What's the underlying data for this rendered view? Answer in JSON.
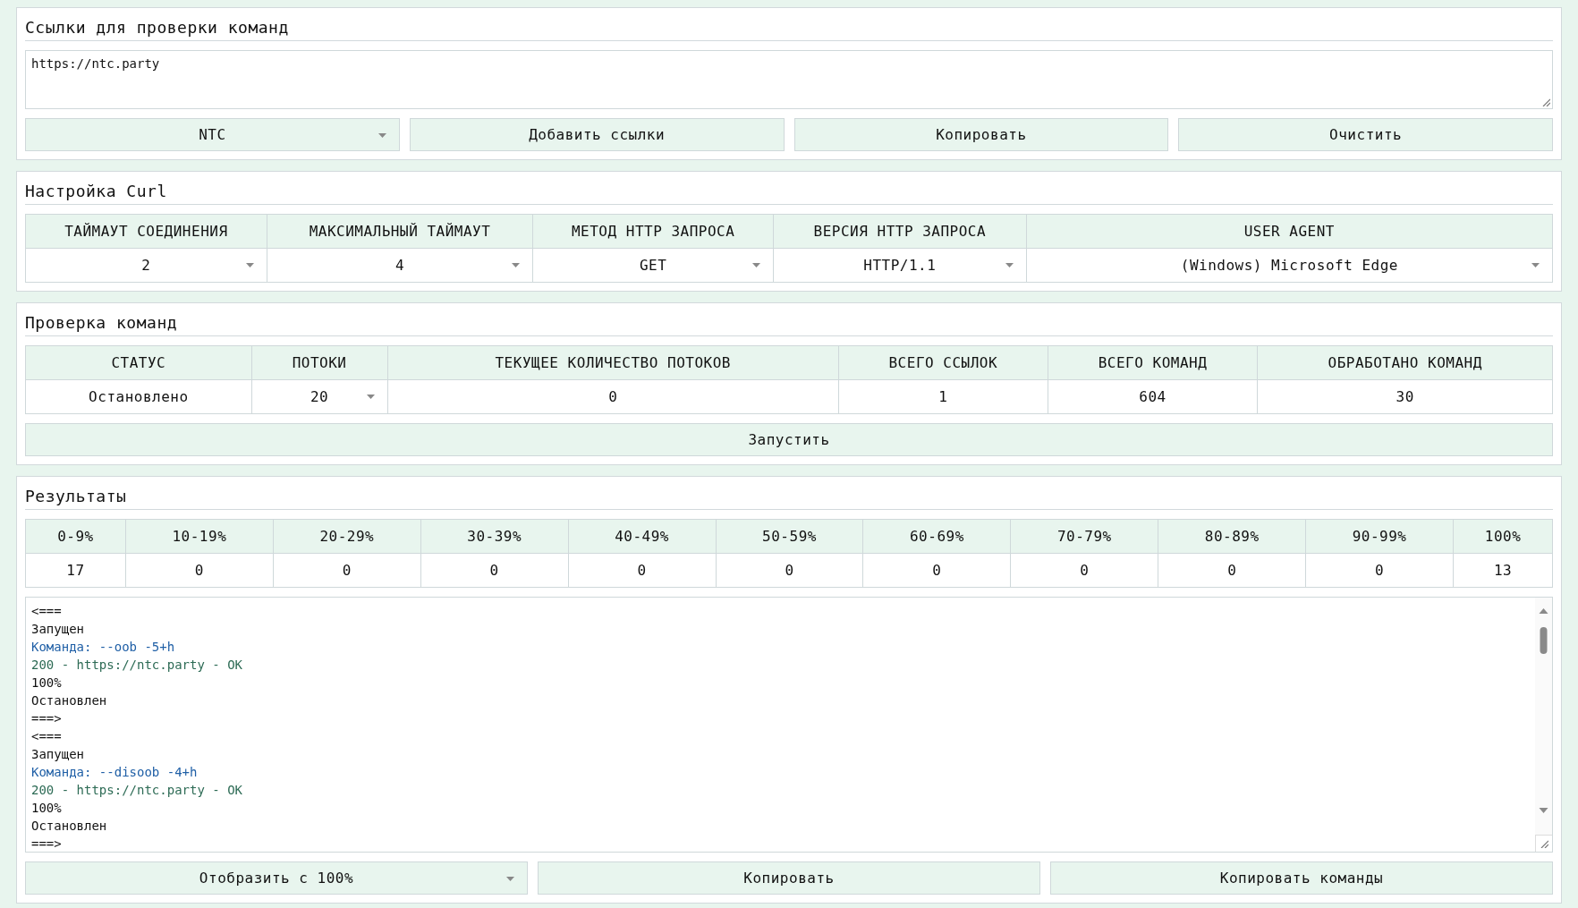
{
  "links_panel": {
    "title": "Ссылки для проверки команд",
    "links_field": {
      "value": "https://ntc.party"
    },
    "controls": [
      {
        "kind": "select",
        "label": "NTC"
      },
      {
        "kind": "button",
        "label": "Добавить ссылки"
      },
      {
        "kind": "button",
        "label": "Копировать"
      },
      {
        "kind": "button",
        "label": "Очистить"
      }
    ]
  },
  "curl_panel": {
    "title": "Настройка Curl",
    "columns": [
      {
        "header": "ТАЙМАУТ СОЕДИНЕНИЯ",
        "value": "2",
        "kind": "select"
      },
      {
        "header": "МАКСИМАЛЬНЫЙ ТАЙМАУТ",
        "value": "4",
        "kind": "select"
      },
      {
        "header": "МЕТОД HTTP ЗАПРОСА",
        "value": "GET",
        "kind": "select"
      },
      {
        "header": "ВЕРСИЯ HTTP ЗАПРОСА",
        "value": "HTTP/1.1",
        "kind": "select"
      },
      {
        "header": "USER AGENT",
        "value": "(Windows) Microsoft Edge",
        "kind": "select"
      }
    ]
  },
  "check_panel": {
    "title": "Проверка команд",
    "columns": [
      {
        "header": "СТАТУС",
        "value": "Остановлено",
        "kind": "text"
      },
      {
        "header": "ПОТОКИ",
        "value": "20",
        "kind": "select"
      },
      {
        "header": "ТЕКУЩЕЕ КОЛИЧЕСТВО ПОТОКОВ",
        "value": "0",
        "kind": "text"
      },
      {
        "header": "ВСЕГО ССЫЛОК",
        "value": "1",
        "kind": "text"
      },
      {
        "header": "ВСЕГО КОМАНД",
        "value": "604",
        "kind": "text"
      },
      {
        "header": "ОБРАБОТАНО КОМАНД",
        "value": "30",
        "kind": "text"
      }
    ],
    "start_button": "Запустить"
  },
  "results_panel": {
    "title": "Результаты",
    "columns": [
      {
        "header": "0-9%",
        "value": "17",
        "kind": "text"
      },
      {
        "header": "10-19%",
        "value": "0",
        "kind": "text"
      },
      {
        "header": "20-29%",
        "value": "0",
        "kind": "text"
      },
      {
        "header": "30-39%",
        "value": "0",
        "kind": "text"
      },
      {
        "header": "40-49%",
        "value": "0",
        "kind": "text"
      },
      {
        "header": "50-59%",
        "value": "0",
        "kind": "text"
      },
      {
        "header": "60-69%",
        "value": "0",
        "kind": "text"
      },
      {
        "header": "70-79%",
        "value": "0",
        "kind": "text"
      },
      {
        "header": "80-89%",
        "value": "0",
        "kind": "text"
      },
      {
        "header": "90-99%",
        "value": "0",
        "kind": "text"
      },
      {
        "header": "100%",
        "value": "13",
        "kind": "text"
      }
    ],
    "log": [
      {
        "kind": "plain",
        "text": "<==="
      },
      {
        "kind": "plain",
        "text": "Запущен"
      },
      {
        "kind": "command",
        "text": "Команда: --oob -5+h"
      },
      {
        "kind": "response",
        "text": "200 - https://ntc.party - OK"
      },
      {
        "kind": "plain",
        "text": "100%"
      },
      {
        "kind": "plain",
        "text": "Остановлен"
      },
      {
        "kind": "plain",
        "text": "===>"
      },
      {
        "kind": "plain",
        "text": "<==="
      },
      {
        "kind": "plain",
        "text": "Запущен"
      },
      {
        "kind": "command",
        "text": "Команда: --disoob -4+h"
      },
      {
        "kind": "response",
        "text": "200 - https://ntc.party - OK"
      },
      {
        "kind": "plain",
        "text": "100%"
      },
      {
        "kind": "plain",
        "text": "Остановлен"
      },
      {
        "kind": "plain",
        "text": "===>"
      }
    ],
    "controls": [
      {
        "kind": "select",
        "label": "Отобразить с 100%"
      },
      {
        "kind": "button",
        "label": "Копировать"
      },
      {
        "kind": "button",
        "label": "Копировать команды"
      }
    ]
  }
}
